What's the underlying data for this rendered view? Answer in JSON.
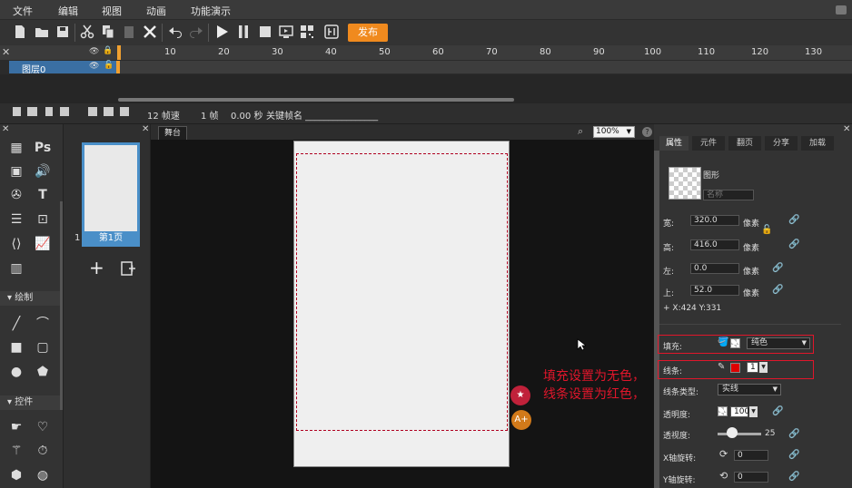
{
  "menu": [
    "文件",
    "编辑",
    "视图",
    "动画",
    "功能演示"
  ],
  "toolbar": {
    "publish_label": "发布"
  },
  "timeline": {
    "ticks": [
      "10",
      "20",
      "30",
      "40",
      "50",
      "60",
      "70",
      "80",
      "90",
      "100",
      "110",
      "120",
      "130"
    ],
    "layer_name": "图层0",
    "fps": "12 帧速",
    "frame": "1 帧",
    "time": "0.00 秒",
    "keyframe_label": "关键帧名 ________________"
  },
  "toolbox": {
    "draw_section": "绘制",
    "control_section": "控件"
  },
  "pages": {
    "page_num": "1",
    "page_label": "第1页"
  },
  "stage": {
    "tab": "舞台",
    "zoom": "100%",
    "help": "?"
  },
  "annotation": {
    "line1": "填充设置为无色，",
    "line2": "线条设置为红色，"
  },
  "props": {
    "tabs": [
      "属性",
      "元件",
      "翻页",
      "分享",
      "加载"
    ],
    "shape_type": "图形",
    "name_placeholder": "名称",
    "width_label": "宽:",
    "width_value": "320.0",
    "unit": "像素",
    "height_label": "高:",
    "height_value": "416.0",
    "left_label": "左:",
    "left_value": "0.0",
    "top_label": "上:",
    "top_value": "52.0",
    "coords": "+ X:424   Y:331",
    "fill_label": "填充:",
    "fill_type": "纯色",
    "stroke_label": "线条:",
    "stroke_width": "1",
    "stroke_type_label": "线条类型:",
    "stroke_type": "实线",
    "opacity_label": "透明度:",
    "opacity_value": "100",
    "perspective_label": "透视度:",
    "perspective_value": "25",
    "xrot_label": "X轴旋转:",
    "xrot_value": "0",
    "yrot_label": "Y轴旋转:",
    "yrot_value": "0"
  },
  "colors": {
    "accent": "#f08a1e",
    "selection": "#4a8fc8",
    "annotation": "#e0162b",
    "stroke": "#dd0000"
  }
}
